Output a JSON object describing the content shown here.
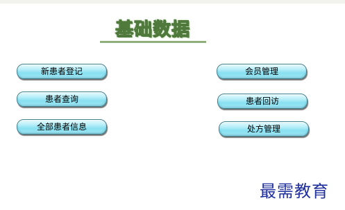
{
  "title": "基础数据",
  "buttons": {
    "new_patient_register": "新患者登记",
    "patient_query": "患者查询",
    "all_patient_info": "全部患者信息",
    "member_management": "会员管理",
    "patient_followup": "患者回访",
    "prescription_management": "处方管理"
  },
  "watermark": "最需教育"
}
